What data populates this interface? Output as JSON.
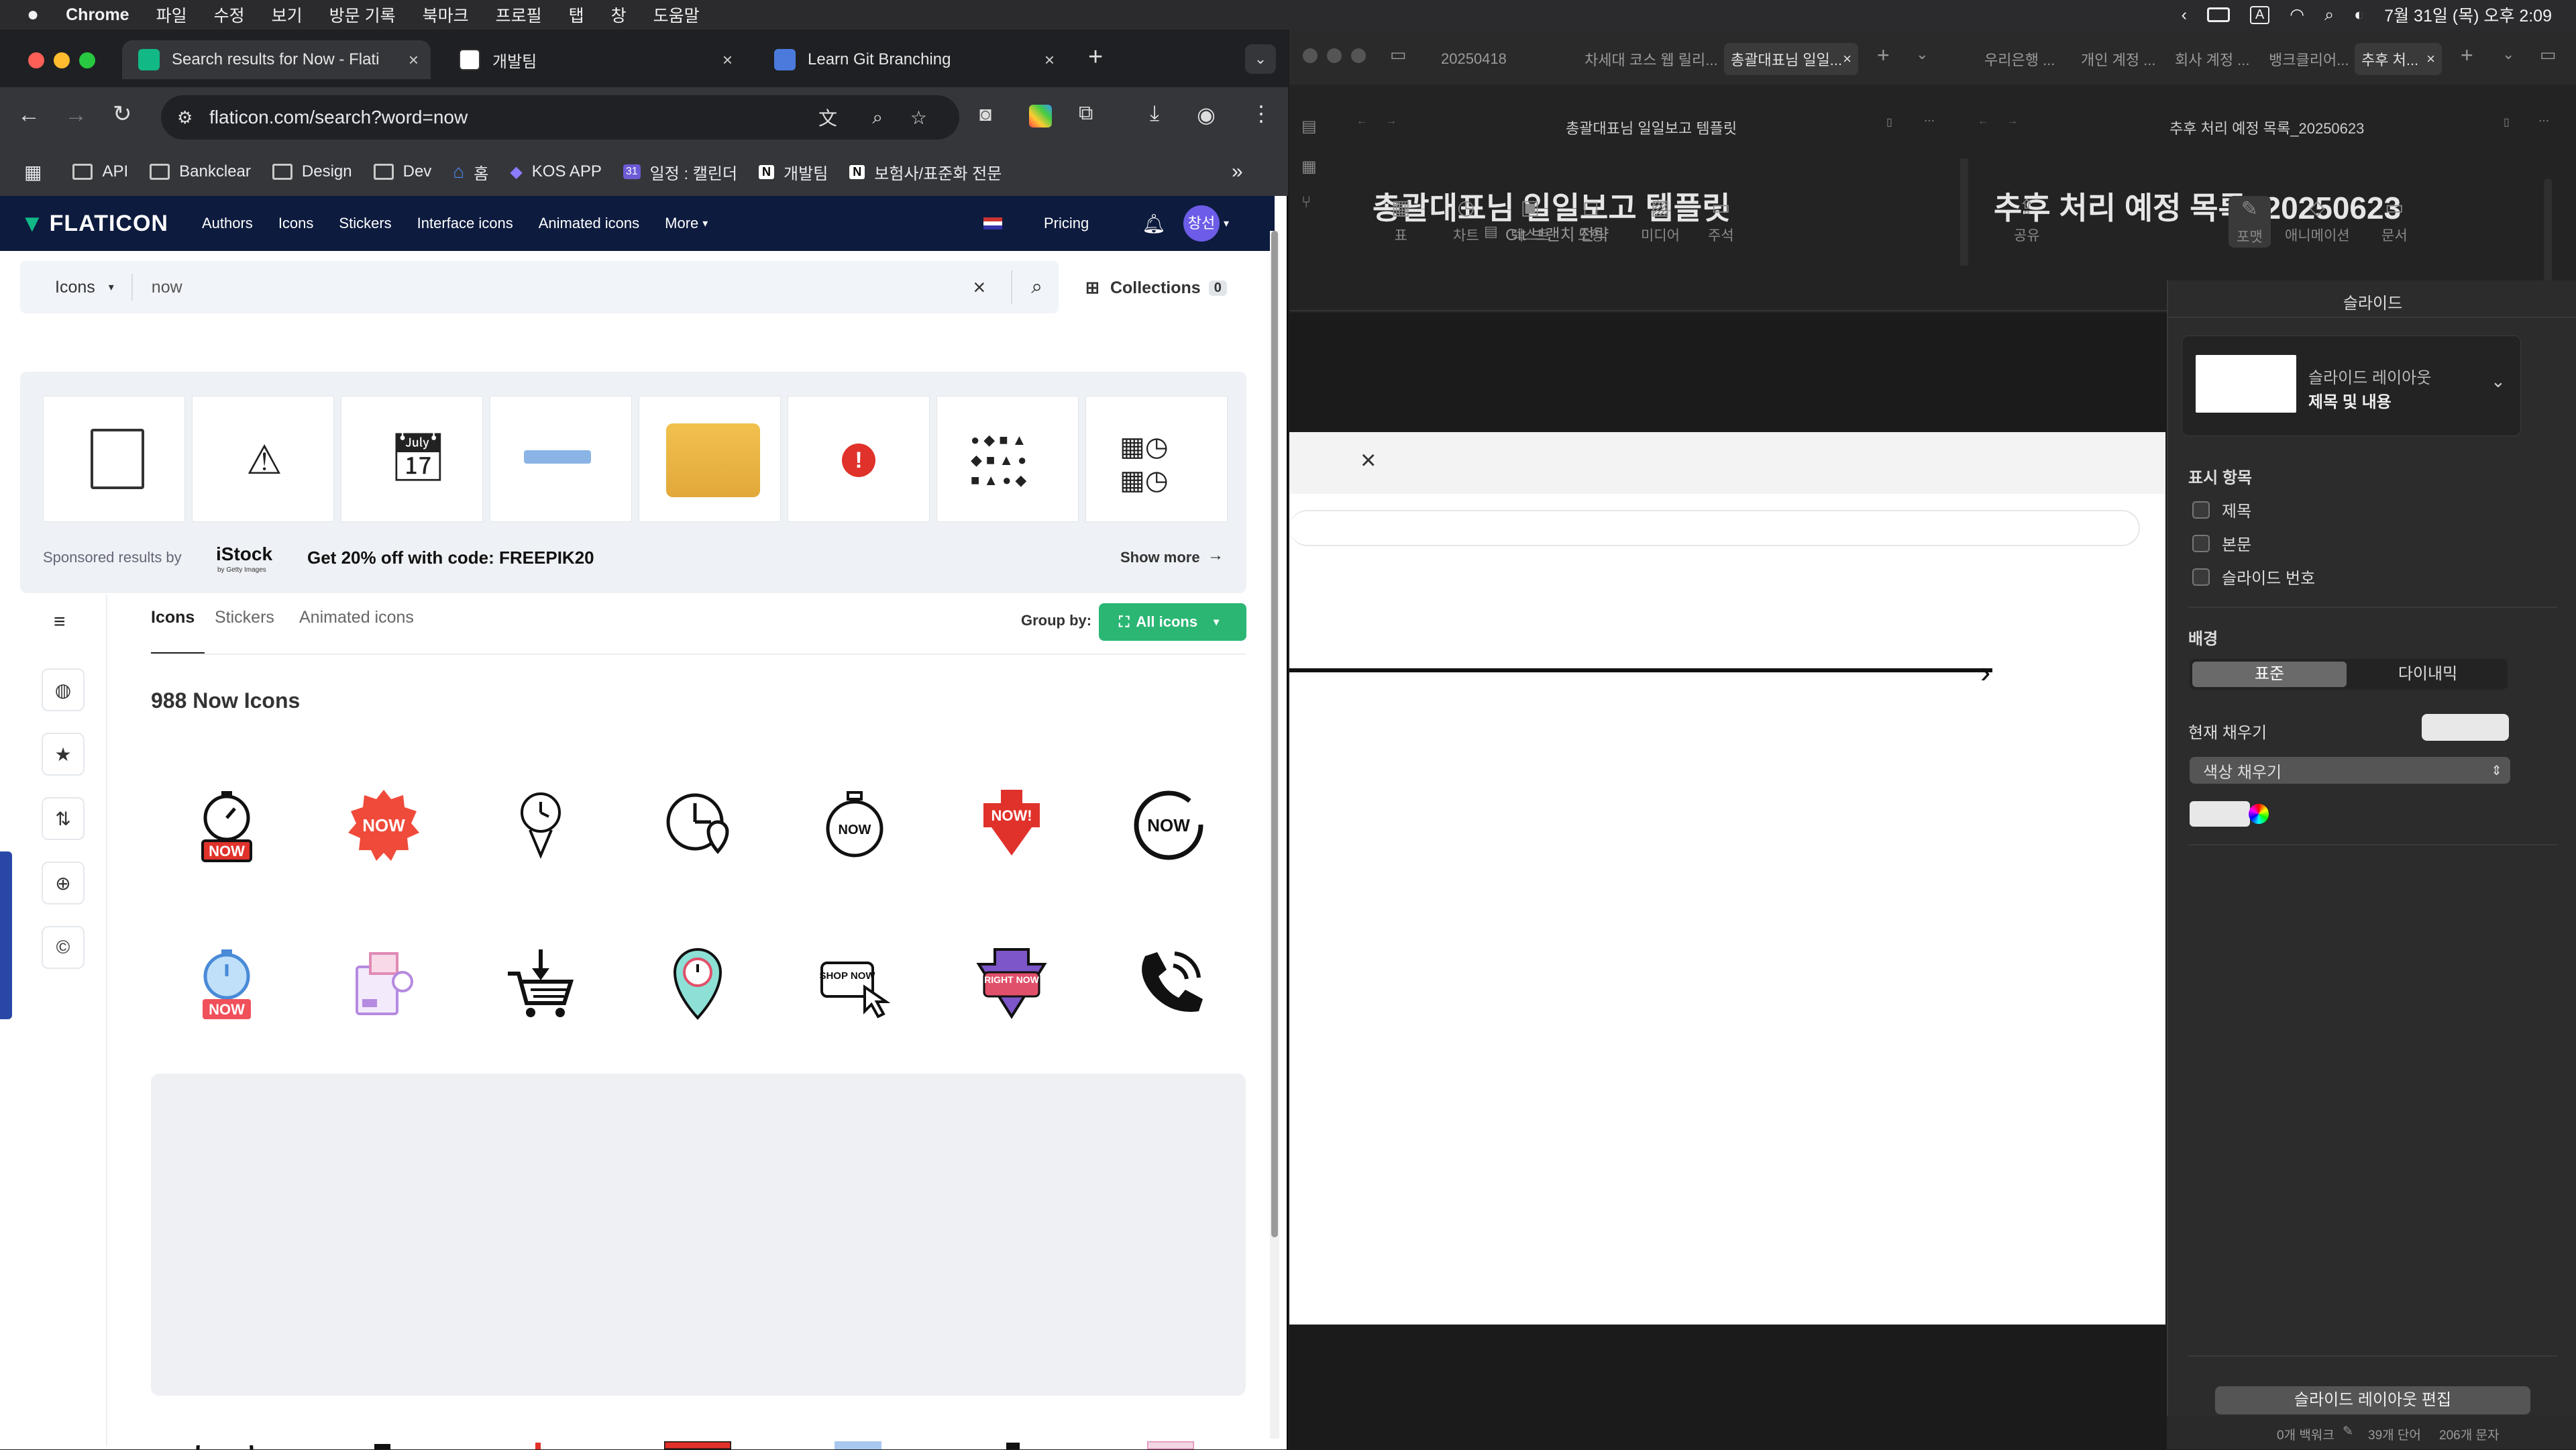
{
  "menubar": {
    "app": "Chrome",
    "menus": [
      "파일",
      "수정",
      "보기",
      "방문 기록",
      "북마크",
      "프로필",
      "탭",
      "창",
      "도움말"
    ],
    "datetime": "7월 31일 (목) 오후 2:09"
  },
  "chrome": {
    "tabs": [
      {
        "title": "Search results for Now - Flati"
      },
      {
        "title": "개발팀"
      },
      {
        "title": "Learn Git Branching"
      }
    ],
    "url": "flaticon.com/search?word=now",
    "bookmarks": [
      "API",
      "Bankclear",
      "Design",
      "Dev",
      "홈",
      "KOS APP",
      "일정 : 캘린더",
      "개발팀",
      "보험사/표준화 전문"
    ]
  },
  "flaticon": {
    "logo": "FLATICON",
    "nav": [
      "Authors",
      "Icons",
      "Stickers",
      "Interface icons",
      "Animated icons",
      "More"
    ],
    "pricing": "Pricing",
    "avatar": "창선",
    "search": {
      "type": "Icons",
      "query": "now"
    },
    "collections_label": "Collections",
    "collections_count": "0",
    "sponsored_label": "Sponsored results by",
    "istock": "iStock",
    "istock_sub": "by Getty Images",
    "promo": "Get 20% off with code: FREEPIK20",
    "show_more": "Show more",
    "subtabs": [
      "Icons",
      "Stickers",
      "Animated icons"
    ],
    "group_by_label": "Group by:",
    "group_by_value": "All icons",
    "result_heading": "988 Now Icons",
    "icon_texts": {
      "now": "NOW",
      "now_excl": "NOW!",
      "shop_now": "SHOP NOW",
      "right_now": "RIGHT NOW"
    }
  },
  "pages": {
    "tabs": [
      "20250418",
      "차세대 코스 웹 릴리...",
      "총괄대표님 일일...",
      "우리은행 ...",
      "개인 계정 ...",
      "회사 계정 ...",
      "뱅크클리어...",
      "추후 처..."
    ],
    "left_doc_title": "총괄대표님 일일보고 템플릿",
    "left_heading": "총괄대표님 일일보고 템플릿",
    "right_doc_title": "추후 처리 예정 목록_20250623",
    "right_heading": "추후 처리 예정 목록_20250623",
    "git_label": "Git 브랜치 전략",
    "tools": [
      "표",
      "차트",
      "텍스트",
      "도형",
      "미디어",
      "주석",
      "공유",
      "포맷",
      "애니메이션",
      "문서"
    ],
    "inspector": {
      "title": "슬라이드",
      "layout_label": "슬라이드 레이아웃",
      "layout_value": "제목 및 내용",
      "show_items": "표시 항목",
      "checkboxes": [
        "제목",
        "본문",
        "슬라이드 번호"
      ],
      "background": "배경",
      "segments": [
        "표준",
        "다이내믹"
      ],
      "current_fill": "현재 채우기",
      "fill_type": "색상 채우기",
      "edit_button": "슬라이드 레이아웃 편집"
    },
    "status": [
      "0개 백워크",
      "39개 단어",
      "206개 문자"
    ]
  }
}
